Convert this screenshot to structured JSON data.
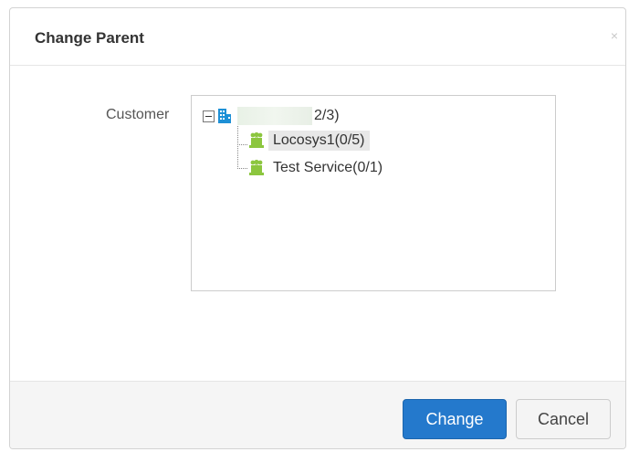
{
  "dialog": {
    "title": "Change Parent",
    "close_glyph": "×"
  },
  "form": {
    "customer_label": "Customer"
  },
  "tree": {
    "root": {
      "label_visible": "2/3)",
      "icon": "building-icon",
      "expanded": true
    },
    "children": [
      {
        "label": "Locosys1(0/5)",
        "icon": "group-icon",
        "selected": true
      },
      {
        "label": "Test Service(0/1)",
        "icon": "group-icon",
        "selected": false
      }
    ]
  },
  "footer": {
    "change_label": "Change",
    "cancel_label": "Cancel"
  },
  "colors": {
    "primary": "#2479cc",
    "group_icon": "#8cc63f",
    "building_icon": "#1e90d6"
  }
}
